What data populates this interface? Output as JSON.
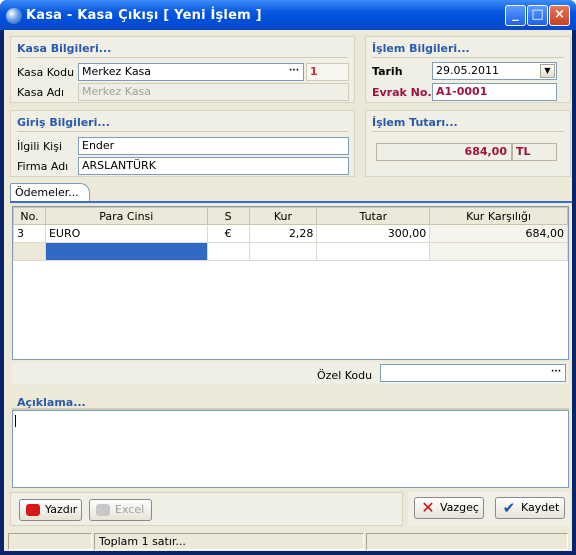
{
  "window": {
    "title": "Kasa - Kasa Çıkışı  [ Yeni İşlem ]",
    "minimize": "_",
    "maximize": "□",
    "close": "×"
  },
  "kasa": {
    "title": "Kasa Bilgileri...",
    "kodu_label": "Kasa Kodu",
    "kodu_value": "Merkez Kasa",
    "kodu_code": "1",
    "adi_label": "Kasa Adı",
    "adi_value": "Merkez Kasa"
  },
  "islem": {
    "title": "İşlem Bilgileri...",
    "tarih_label": "Tarih",
    "tarih_value": "29.05.2011",
    "evrak_label": "Evrak No.",
    "evrak_value": "A1-0001"
  },
  "giris": {
    "title": "Giriş Bilgileri...",
    "kisi_label": "İlgili Kişi",
    "kisi_value": "Ender",
    "firma_label": "Firma Adı",
    "firma_value": "ARSLANTÜRK"
  },
  "tutar": {
    "title": "İşlem Tutarı...",
    "value": "684,00",
    "currency": "TL"
  },
  "tabs": {
    "odemeler": "Ödemeler..."
  },
  "grid": {
    "headers": [
      "No.",
      "Para Cinsi",
      "S",
      "Kur",
      "Tutar",
      "Kur Karşılığı"
    ],
    "rows": [
      {
        "no": "3",
        "para": "EURO",
        "s": "€",
        "kur": "2,28",
        "tutar": "300,00",
        "karsilik": "684,00"
      }
    ]
  },
  "ozel": {
    "label": "Özel Kodu",
    "value": ""
  },
  "aciklama": {
    "title": "Açıklama...",
    "value": ""
  },
  "buttons": {
    "yazdir": "Yazdır",
    "excel": "Excel",
    "vazgec": "Vazgeç",
    "kaydet": "Kaydet"
  },
  "ellipsis": "···",
  "dropdown_arrow": "▼",
  "status": {
    "message": "Toplam 1 satır..."
  }
}
